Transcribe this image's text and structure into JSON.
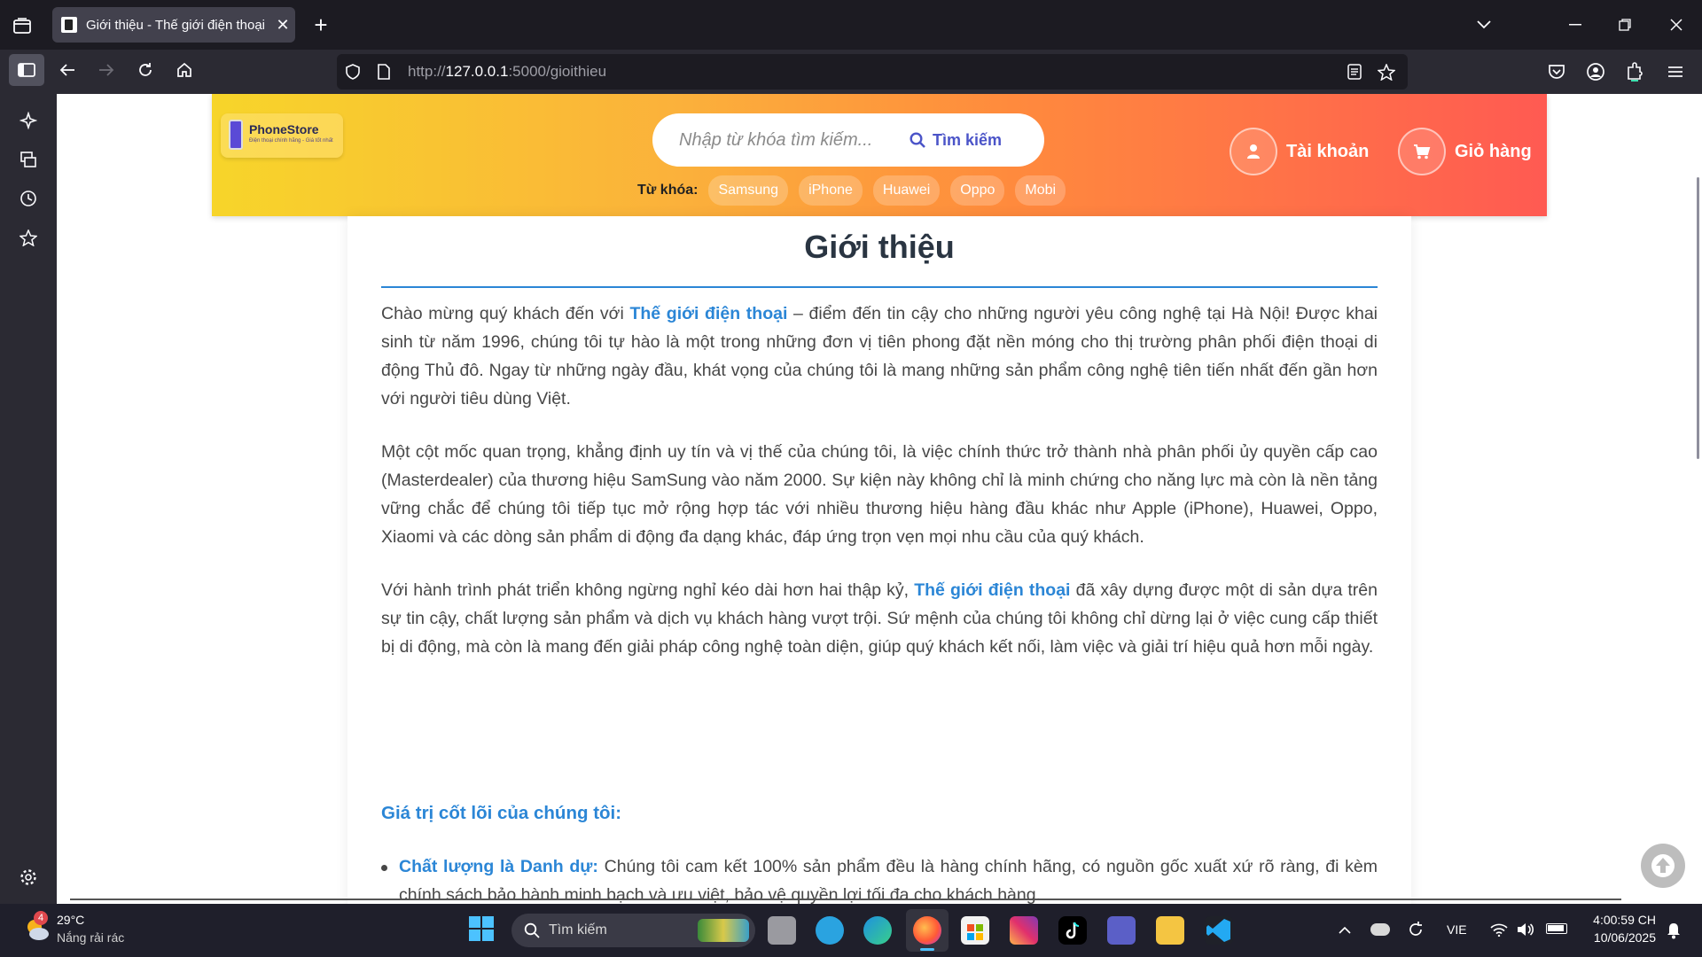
{
  "browser": {
    "tab_title": "Giới thiệu - Thế giới điện thoại",
    "url": "http://127.0.0.1:5000/gioithieu",
    "url_host": "127.0.0.1",
    "url_prefix": "http://",
    "url_suffix": ":5000/gioithieu"
  },
  "header": {
    "logo_name": "PhoneStore",
    "logo_tagline": "Điện thoại chính hãng - Giá tốt nhất",
    "search_placeholder": "Nhập từ khóa tìm kiếm...",
    "search_button": "Tìm kiếm",
    "keywords_label": "Từ khóa:",
    "keywords": [
      "Samsung",
      "iPhone",
      "Huawei",
      "Oppo",
      "Mobi"
    ],
    "account_label": "Tài khoản",
    "cart_label": "Giỏ hàng"
  },
  "content": {
    "title": "Giới thiệu",
    "p1_a": "Chào mừng quý khách đến với ",
    "p1_hl": "Thế giới điện thoại",
    "p1_b": " – điểm đến tin cậy cho những người yêu công nghệ tại Hà Nội! Được khai sinh từ năm 1996, chúng tôi tự hào là một trong những đơn vị tiên phong đặt nền móng cho thị trường phân phối điện thoại di động Thủ đô. Ngay từ những ngày đầu, khát vọng của chúng tôi là mang những sản phẩm công nghệ tiên tiến nhất đến gần hơn với người tiêu dùng Việt.",
    "p2": "Một cột mốc quan trọng, khẳng định uy tín và vị thế của chúng tôi, là việc chính thức trở thành nhà phân phối ủy quyền cấp cao (Masterdealer) của thương hiệu SamSung vào năm 2000. Sự kiện này không chỉ là minh chứng cho năng lực mà còn là nền tảng vững chắc để chúng tôi tiếp tục mở rộng hợp tác với nhiều thương hiệu hàng đầu khác như Apple (iPhone), Huawei, Oppo, Xiaomi và các dòng sản phẩm di động đa dạng khác, đáp ứng trọn vẹn mọi nhu cầu của quý khách.",
    "p3_a": "Với hành trình phát triển không ngừng nghỉ kéo dài hơn hai thập kỷ, ",
    "p3_hl": "Thế giới điện thoại",
    "p3_b": " đã xây dựng được một di sản dựa trên sự tin cậy, chất lượng sản phẩm và dịch vụ khách hàng vượt trội. Sứ mệnh của chúng tôi không chỉ dừng lại ở việc cung cấp thiết bị di động, mà còn là mang đến giải pháp công nghệ toàn diện, giúp quý khách kết nối, làm việc và giải trí hiệu quả hơn mỗi ngày.",
    "values_heading": "Giá trị cốt lõi của chúng tôi:",
    "bullet1_hl": "Chất lượng là Danh dự:",
    "bullet1_text": " Chúng tôi cam kết 100% sản phẩm đều là hàng chính hãng, có nguồn gốc xuất xứ rõ ràng, đi kèm chính sách bảo hành minh bạch và ưu việt, bảo vệ quyền lợi tối đa cho khách hàng."
  },
  "taskbar": {
    "weather_badge": "4",
    "temperature": "29°C",
    "weather_desc": "Nắng rải rác",
    "search_label": "Tìm kiếm",
    "language": "VIE",
    "time": "4:00:59 CH",
    "date": "10/06/2025"
  },
  "colors": {
    "accent_blue": "#2b86d6",
    "header_gradient_start": "#f7d52a",
    "header_gradient_end": "#ff5a52",
    "search_button": "#4b54c8"
  }
}
